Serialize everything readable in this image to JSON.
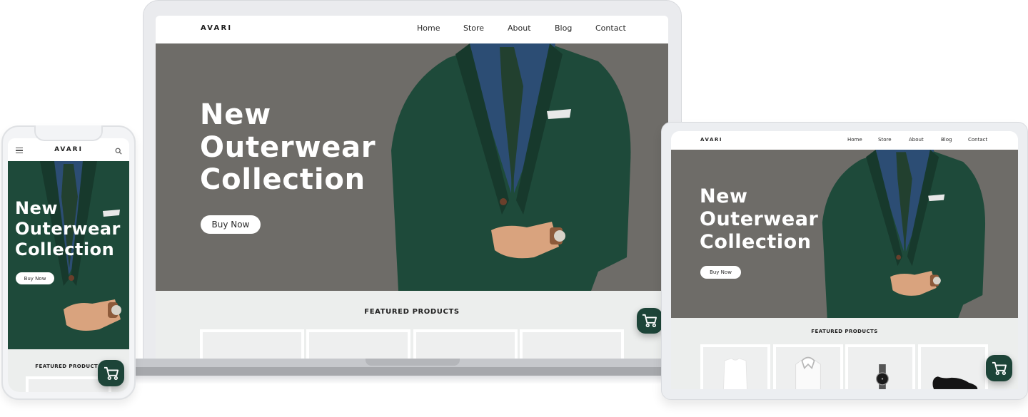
{
  "brand": {
    "name": "AVARI",
    "accent_color": "#1d4438",
    "hero_bg_color": "#6e6c68"
  },
  "nav": {
    "items": [
      {
        "label": "Home"
      },
      {
        "label": "Store"
      },
      {
        "label": "About"
      },
      {
        "label": "Blog"
      },
      {
        "label": "Contact"
      }
    ]
  },
  "hero": {
    "title_lines": [
      "New",
      "Outerwear",
      "Collection"
    ],
    "cta_label": "Buy Now"
  },
  "featured": {
    "title": "FEATURED PRODUCTS",
    "products": [
      {
        "icon": "tshirt-icon"
      },
      {
        "icon": "dress-shirt-icon"
      },
      {
        "icon": "wristwatch-icon"
      },
      {
        "icon": "loafer-shoe-icon"
      }
    ]
  },
  "icons": {
    "cart": "shopping-cart-icon",
    "menu": "hamburger-menu-icon",
    "search": "search-icon"
  },
  "devices": [
    "laptop",
    "phone",
    "tablet"
  ]
}
